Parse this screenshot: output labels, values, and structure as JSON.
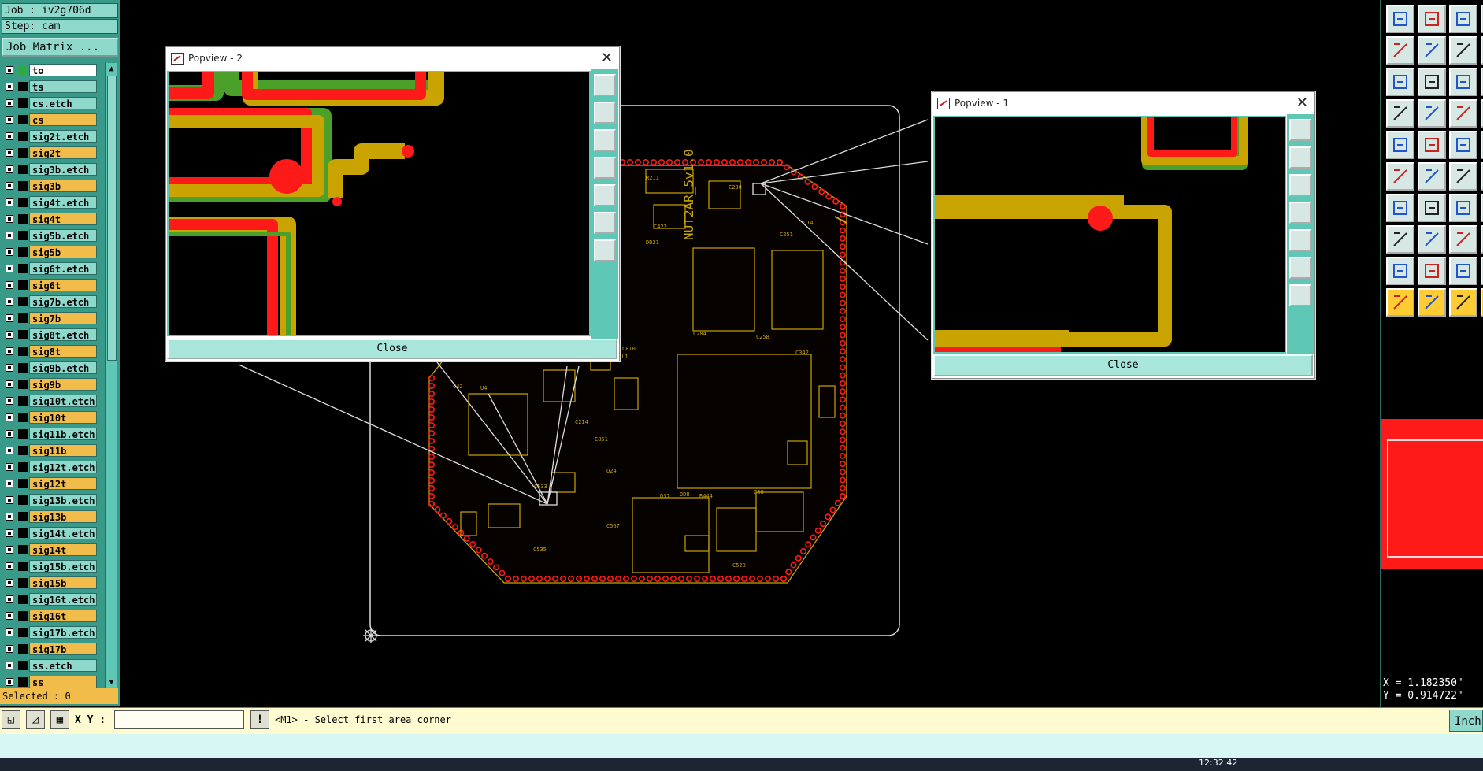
{
  "job_label": "Job : iv2g706d",
  "step_label": "Step: cam",
  "job_matrix_label": "Job Matrix ...",
  "layers": [
    {
      "name": "to",
      "kind": "white"
    },
    {
      "name": "ts",
      "kind": "teal"
    },
    {
      "name": "cs.etch",
      "kind": "teal"
    },
    {
      "name": "cs",
      "kind": "orange"
    },
    {
      "name": "sig2t.etch",
      "kind": "teal"
    },
    {
      "name": "sig2t",
      "kind": "orange"
    },
    {
      "name": "sig3b.etch",
      "kind": "teal"
    },
    {
      "name": "sig3b",
      "kind": "orange"
    },
    {
      "name": "sig4t.etch",
      "kind": "teal"
    },
    {
      "name": "sig4t",
      "kind": "orange"
    },
    {
      "name": "sig5b.etch",
      "kind": "teal"
    },
    {
      "name": "sig5b",
      "kind": "orange"
    },
    {
      "name": "sig6t.etch",
      "kind": "teal"
    },
    {
      "name": "sig6t",
      "kind": "orange"
    },
    {
      "name": "sig7b.etch",
      "kind": "teal"
    },
    {
      "name": "sig7b",
      "kind": "orange"
    },
    {
      "name": "sig8t.etch",
      "kind": "teal"
    },
    {
      "name": "sig8t",
      "kind": "orange"
    },
    {
      "name": "sig9b.etch",
      "kind": "teal"
    },
    {
      "name": "sig9b",
      "kind": "orange"
    },
    {
      "name": "sig10t.etch",
      "kind": "teal"
    },
    {
      "name": "sig10t",
      "kind": "orange"
    },
    {
      "name": "sig11b.etch",
      "kind": "teal"
    },
    {
      "name": "sig11b",
      "kind": "orange"
    },
    {
      "name": "sig12t.etch",
      "kind": "teal"
    },
    {
      "name": "sig12t",
      "kind": "orange"
    },
    {
      "name": "sig13b.etch",
      "kind": "teal"
    },
    {
      "name": "sig13b",
      "kind": "orange"
    },
    {
      "name": "sig14t.etch",
      "kind": "teal"
    },
    {
      "name": "sig14t",
      "kind": "orange"
    },
    {
      "name": "sig15b.etch",
      "kind": "teal"
    },
    {
      "name": "sig15b",
      "kind": "orange"
    },
    {
      "name": "sig16t.etch",
      "kind": "teal"
    },
    {
      "name": "sig16t",
      "kind": "orange"
    },
    {
      "name": "sig17b.etch",
      "kind": "teal"
    },
    {
      "name": "sig17b",
      "kind": "orange"
    },
    {
      "name": "ss.etch",
      "kind": "teal"
    },
    {
      "name": "ss",
      "kind": "orange"
    }
  ],
  "selected_label": "Selected : 0",
  "popview2": {
    "title": "Popview - 2",
    "close_label": "Close"
  },
  "popview1": {
    "title": "Popview - 1",
    "close_label": "Close"
  },
  "xy_label": "X Y :",
  "xy_value": "",
  "status_prompt": "<M1> - Select first area corner",
  "units_label": "Inch",
  "coords": {
    "x": "X = 1.182350\"",
    "y": "Y = 0.914722\""
  },
  "clock": "12:32:42",
  "colors": {
    "teal": "#8fd8cc",
    "orange": "#f2bc4a",
    "white": "#ffffff",
    "board_line": "#c9a400",
    "pad_red": "#ff1a1a",
    "trace_green": "#4aa028"
  }
}
